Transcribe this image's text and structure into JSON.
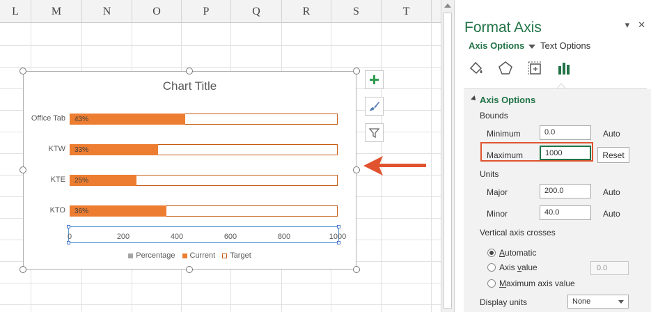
{
  "spreadsheet": {
    "columns": [
      "L",
      "M",
      "N",
      "O",
      "P",
      "Q",
      "R",
      "S",
      "T"
    ]
  },
  "chart": {
    "floating_buttons": [
      "chart-elements",
      "chart-styles",
      "chart-filters"
    ]
  },
  "chart_data": {
    "type": "bar",
    "title": "Chart Title",
    "categories": [
      "Office Tab",
      "KTW",
      "KTE",
      "KTO"
    ],
    "series": [
      {
        "name": "Percentage",
        "values": [
          43,
          33,
          25,
          36
        ],
        "labels": [
          "43%",
          "33%",
          "25%",
          "36%"
        ],
        "color": "#a5a5a5"
      },
      {
        "name": "Current",
        "values": [
          430,
          330,
          250,
          360
        ],
        "color": "#ed7d31"
      },
      {
        "name": "Target",
        "values": [
          1000,
          1000,
          1000,
          1000
        ],
        "color": "#ffffff"
      }
    ],
    "x_ticks": [
      "0",
      "200",
      "400",
      "600",
      "800",
      "1000"
    ],
    "xlim": [
      0,
      1000
    ],
    "legend_position": "bottom",
    "grid": false
  },
  "pane": {
    "title": "Format Axis",
    "tabs": {
      "active": "Axis Options",
      "inactive": "Text Options"
    },
    "icons": [
      "fill-line-icon",
      "effects-icon",
      "size-properties-icon",
      "axis-options-icon"
    ],
    "section_title": "Axis Options",
    "bounds": {
      "header": "Bounds",
      "minimum": {
        "label": "Minimum",
        "value": "0.0",
        "state": "Auto"
      },
      "maximum": {
        "label": "Maximum",
        "value": "1000",
        "button": "Reset"
      }
    },
    "units": {
      "header": "Units",
      "major": {
        "label": "Major",
        "value": "200.0",
        "state": "Auto"
      },
      "minor": {
        "label": "Minor",
        "value": "40.0",
        "state": "Auto"
      }
    },
    "crosses": {
      "header": "Vertical axis crosses",
      "automatic": "Automatic",
      "axis_value": "Axis value",
      "axis_value_field": "0.0",
      "max_axis_value": "Maximum axis value"
    },
    "display_units": {
      "label": "Display units",
      "value": "None"
    }
  },
  "colors": {
    "accent_green": "#217346",
    "bar_orange": "#ed7d31",
    "highlight_red": "#e0532e"
  }
}
